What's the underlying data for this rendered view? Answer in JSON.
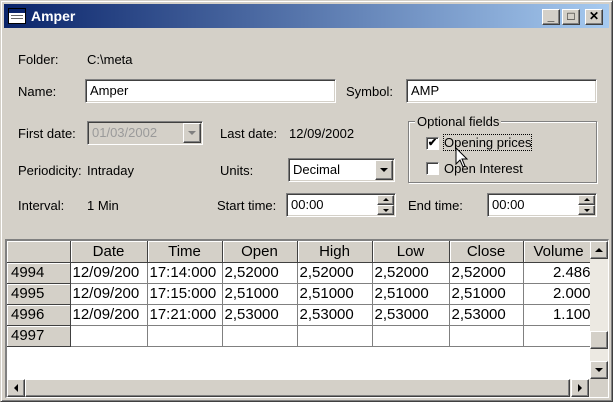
{
  "window": {
    "title": "Amper"
  },
  "form": {
    "folder_label": "Folder:",
    "folder_value": "C:\\meta",
    "name_label": "Name:",
    "name_value": "Amper",
    "symbol_label": "Symbol:",
    "symbol_value": "AMP",
    "first_date_label": "First date:",
    "first_date_value": "01/03/2002",
    "last_date_label": "Last date:",
    "last_date_value": "12/09/2002",
    "periodicity_label": "Periodicity:",
    "periodicity_value": "Intraday",
    "units_label": "Units:",
    "units_value": "Decimal",
    "interval_label": "Interval:",
    "interval_value": "1 Min",
    "start_time_label": "Start time:",
    "start_time_value": "00:00",
    "end_time_label": "End time:",
    "end_time_value": "00:00"
  },
  "optional_fields": {
    "title": "Optional fields",
    "opening_prices_label": "Opening prices",
    "opening_prices_checked": true,
    "open_interest_label": "Open Interest",
    "open_interest_checked": false
  },
  "grid": {
    "columns": [
      "Date",
      "Time",
      "Open",
      "High",
      "Low",
      "Close",
      "Volume"
    ],
    "rows": [
      {
        "id": "4994",
        "cells": [
          "12/09/200",
          "17:14:000",
          "2,52000",
          "2,52000",
          "2,52000",
          "2,52000",
          "2.486"
        ]
      },
      {
        "id": "4995",
        "cells": [
          "12/09/200",
          "17:15:000",
          "2,51000",
          "2,51000",
          "2,51000",
          "2,51000",
          "2.000"
        ]
      },
      {
        "id": "4996",
        "cells": [
          "12/09/200",
          "17:21:000",
          "2,53000",
          "2,53000",
          "2,53000",
          "2,53000",
          "1.100"
        ]
      },
      {
        "id": "4997",
        "cells": [
          "",
          "",
          "",
          "",
          "",
          "",
          ""
        ]
      }
    ]
  },
  "icons": {
    "check_mark": "✔",
    "minimize": "_",
    "maximize": "□",
    "close": "✕"
  }
}
